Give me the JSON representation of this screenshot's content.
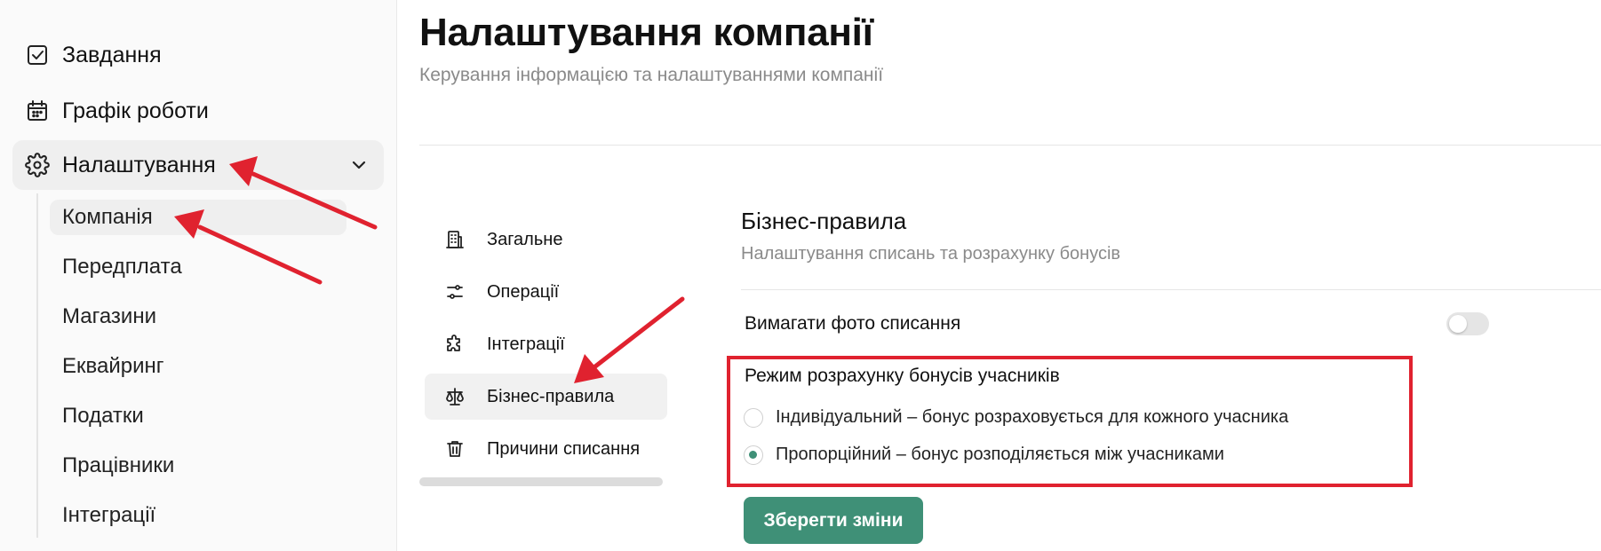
{
  "sidebar": {
    "items": [
      {
        "label": "Завдання",
        "icon": "checkbox-icon"
      },
      {
        "label": "Графік роботи",
        "icon": "calendar-icon"
      }
    ],
    "settings": {
      "label": "Налаштування",
      "icon": "gear-icon",
      "expanded_icon": "chevron-down-icon"
    },
    "sub_items": [
      {
        "label": "Компанія",
        "active": true
      },
      {
        "label": "Передплата"
      },
      {
        "label": "Магазини"
      },
      {
        "label": "Еквайринг"
      },
      {
        "label": "Податки"
      },
      {
        "label": "Працівники"
      },
      {
        "label": "Інтеграції"
      }
    ]
  },
  "page": {
    "title": "Налаштування компанії",
    "subtitle": "Керування інформацією та налаштуваннями компанії"
  },
  "tabs": [
    {
      "label": "Загальне",
      "icon": "building-icon"
    },
    {
      "label": "Операції",
      "icon": "sliders-icon"
    },
    {
      "label": "Інтеграції",
      "icon": "puzzle-icon"
    },
    {
      "label": "Бізнес-правила",
      "icon": "scales-icon",
      "active": true
    },
    {
      "label": "Причини списання",
      "icon": "trash-icon"
    }
  ],
  "business_rules": {
    "title": "Бізнес-правила",
    "subtitle": "Налаштування списань та розрахунку бонусів",
    "require_photo_label": "Вимагати фото списання",
    "require_photo_enabled": false,
    "bonus_mode_title": "Режим розрахунку бонусів учасників",
    "bonus_mode_options": [
      {
        "label": "Індивідуальний – бонус розраховується для кожного учасника",
        "selected": false
      },
      {
        "label": "Пропорційний – бонус розподіляється між учасниками",
        "selected": true
      }
    ],
    "save_label": "Зберегти зміни"
  },
  "colors": {
    "accent": "#3f9077",
    "annotation": "#e0222f",
    "active_bg": "#efefef"
  }
}
